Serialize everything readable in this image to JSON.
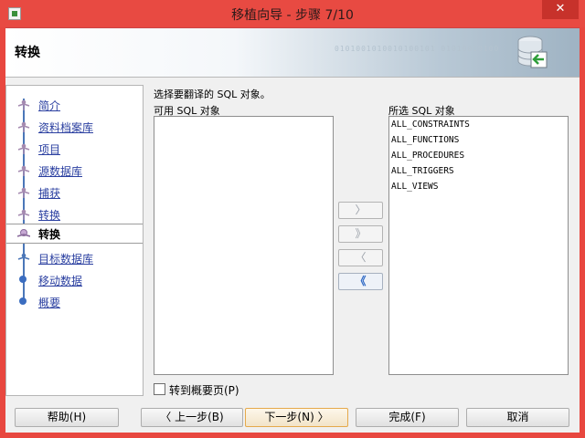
{
  "window": {
    "title": "移植向导 - 步骤 7/10",
    "close_glyph": "✕"
  },
  "banner": {
    "title": "转换",
    "deco_text": "0101001010010100101 01010010100"
  },
  "sidebar": {
    "items": [
      {
        "label": "简介",
        "marker": "figure"
      },
      {
        "label": "资料档案库",
        "marker": "figure"
      },
      {
        "label": "项目",
        "marker": "figure"
      },
      {
        "label": "源数据库",
        "marker": "figure"
      },
      {
        "label": "捕获",
        "marker": "figure"
      },
      {
        "label": "转换",
        "marker": "figure"
      },
      {
        "label": "转换",
        "marker": "figure-active",
        "active": true
      },
      {
        "label": "目标数据库",
        "marker": "figure"
      },
      {
        "label": "移动数据",
        "marker": "dot"
      },
      {
        "label": "概要",
        "marker": "dot"
      }
    ]
  },
  "main": {
    "instruction": "选择要翻译的 SQL 对象。",
    "available_label": "可用 SQL 对象",
    "selected_label": "所选 SQL 对象",
    "available_items": [],
    "selected_items": [
      "ALL_CONSTRAINTS",
      "ALL_FUNCTIONS",
      "ALL_PROCEDURES",
      "ALL_TRIGGERS",
      "ALL_VIEWS"
    ],
    "shuttle": {
      "move_right": "〉",
      "move_all_right": "》",
      "move_left": "〈",
      "move_all_left": "《"
    },
    "checkbox_label": "转到概要页(P)"
  },
  "buttons": {
    "help": "帮助(H)",
    "back": "〈 上一步(B)",
    "next": "下一步(N) 〉",
    "finish": "完成(F)",
    "cancel": "取消"
  },
  "colors": {
    "titlebar": "#e84a42",
    "link": "#2a3fa0",
    "accent": "#2d68c4"
  }
}
